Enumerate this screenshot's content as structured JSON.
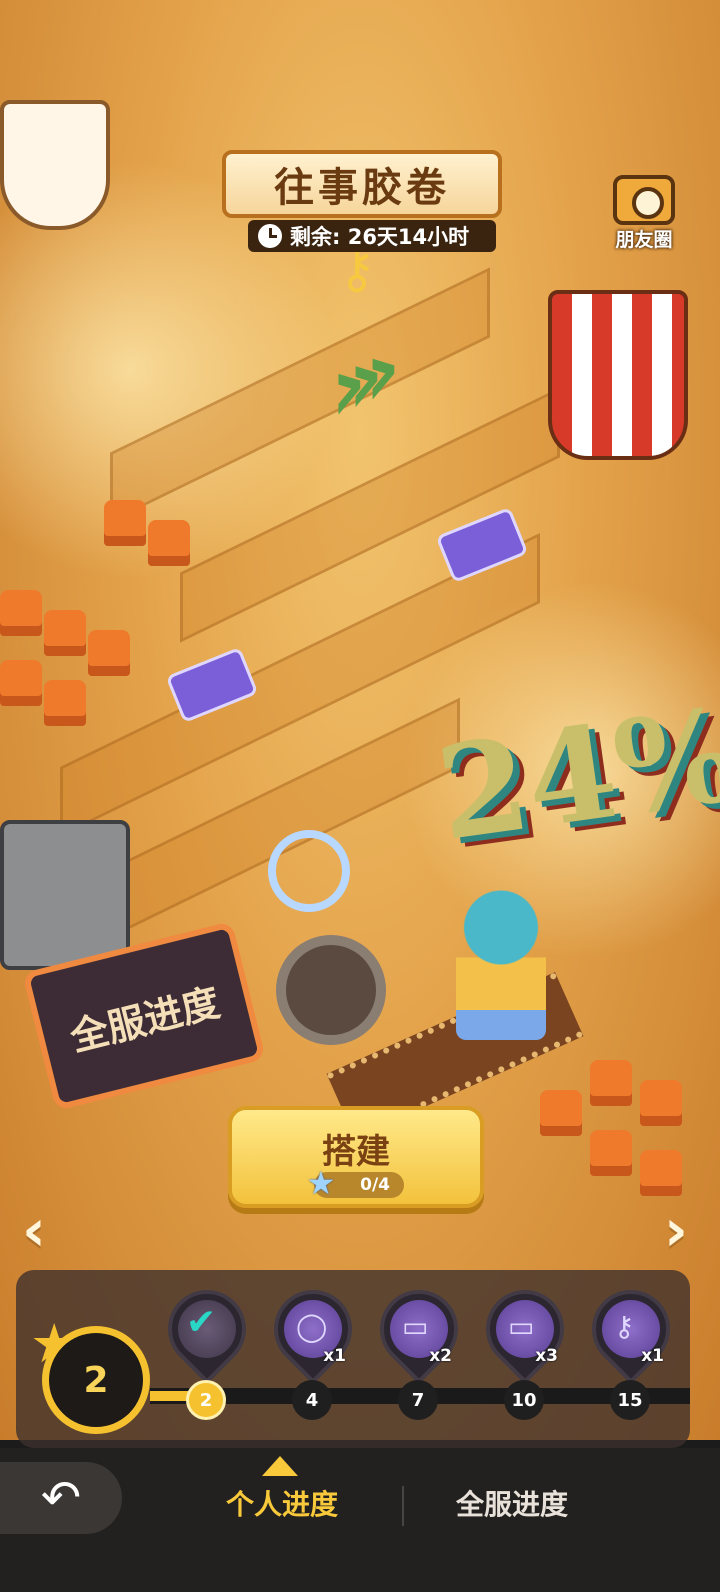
{
  "event": {
    "title": "往事胶卷",
    "remaining": "剩余: 26天14小时",
    "moments_label": "朋友圈",
    "server_progress_percent": "24%",
    "server_progress_sign": "全服进度"
  },
  "build": {
    "label": "搭建",
    "count": "0/4"
  },
  "progress": {
    "current_level": "2",
    "rewards": [
      {
        "icon": "checkmark-icon",
        "qty": "",
        "claimed": true,
        "threshold": "2"
      },
      {
        "icon": "ring-icon",
        "qty": "x1",
        "claimed": false,
        "threshold": "4"
      },
      {
        "icon": "ticket-icon",
        "qty": "x2",
        "claimed": false,
        "threshold": "7"
      },
      {
        "icon": "ticket-icon",
        "qty": "x3",
        "claimed": false,
        "threshold": "10"
      },
      {
        "icon": "key-icon",
        "qty": "x1",
        "claimed": false,
        "threshold": "15"
      }
    ]
  },
  "tabs": {
    "personal": "个人进度",
    "server": "全服进度"
  },
  "colors": {
    "accent": "#f5c12f",
    "tab_active": "#f8c93a",
    "percent_shadow": "#2f8680"
  }
}
